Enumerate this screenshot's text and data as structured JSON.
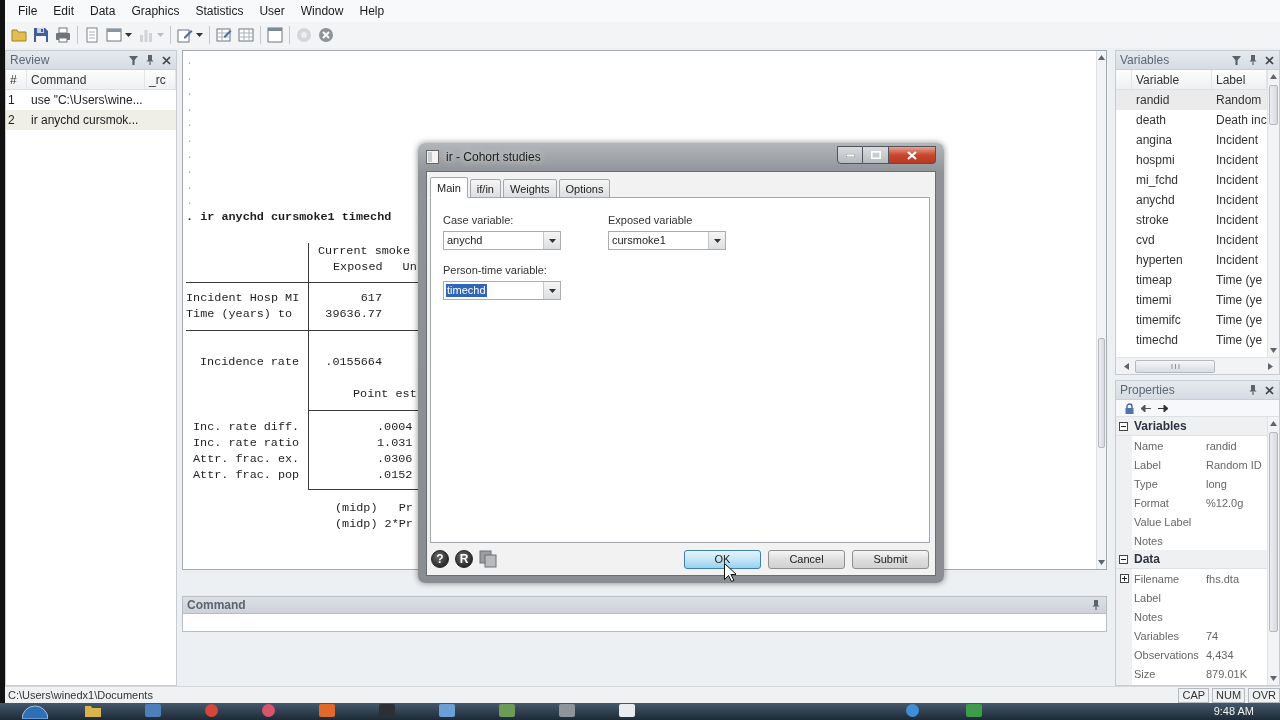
{
  "menu_bar": [
    "File",
    "Edit",
    "Data",
    "Graphics",
    "Statistics",
    "User",
    "Window",
    "Help"
  ],
  "review": {
    "title": "Review",
    "columns": [
      "#",
      "Command",
      "_rc"
    ],
    "rows": [
      {
        "number": "1",
        "command": "use \"C:\\Users\\wine...",
        "selected": false
      },
      {
        "number": "2",
        "command": "ir anychd cursmok...",
        "selected": true
      }
    ]
  },
  "results": {
    "echo_lines": [
      ".",
      ".",
      ".",
      ".",
      ".",
      ".",
      ".",
      ".",
      ".",
      "."
    ],
    "command": ". ir anychd cursmoke1 timechd",
    "table": {
      "header_lines": [
        [
          "Current smoke"
        ],
        [
          "Exposed",
          "Un"
        ]
      ],
      "count_rows": [
        {
          "label": "Incident Hosp MI",
          "value": "617"
        },
        {
          "label": "Time (years) to",
          "value": "39636.77"
        }
      ],
      "rate_row": {
        "label": "Incidence rate",
        "value": ".0155664"
      },
      "estimate_heading": "Point est",
      "estimate_rows": [
        {
          "label": "Inc. rate diff.",
          "value": ".0004"
        },
        {
          "label": "Inc. rate ratio",
          "value": "1.031"
        },
        {
          "label": "Attr. frac. ex.",
          "value": ".0306"
        },
        {
          "label": "Attr. frac. pop",
          "value": ".0152"
        }
      ]
    },
    "test_lines": [
      [
        "(midp)",
        "Pr"
      ],
      [
        "(midp)",
        "2*Pr"
      ]
    ]
  },
  "command_window": {
    "title": "Command"
  },
  "variables": {
    "title": "Variables",
    "columns": [
      "Variable",
      "Label"
    ],
    "rows": [
      {
        "name": "randid",
        "label": "Random",
        "selected": true
      },
      {
        "name": "death",
        "label": "Death inc",
        "selected": false
      },
      {
        "name": "angina",
        "label": "Incident",
        "selected": false
      },
      {
        "name": "hospmi",
        "label": "Incident",
        "selected": false
      },
      {
        "name": "mi_fchd",
        "label": "Incident",
        "selected": false
      },
      {
        "name": "anychd",
        "label": "Incident",
        "selected": false
      },
      {
        "name": "stroke",
        "label": "Incident",
        "selected": false
      },
      {
        "name": "cvd",
        "label": "Incident",
        "selected": false
      },
      {
        "name": "hyperten",
        "label": "Incident",
        "selected": false
      },
      {
        "name": "timeap",
        "label": "Time (ye",
        "selected": false
      },
      {
        "name": "timemi",
        "label": "Time (ye",
        "selected": false
      },
      {
        "name": "timemifc",
        "label": "Time (ye",
        "selected": false
      },
      {
        "name": "timechd",
        "label": "Time (ye",
        "selected": false
      }
    ]
  },
  "properties": {
    "title": "Properties",
    "groups": [
      {
        "title": "Variables",
        "expanded": true,
        "rows": [
          {
            "name": "Name",
            "value": "randid"
          },
          {
            "name": "Label",
            "value": "Random ID"
          },
          {
            "name": "Type",
            "value": "long"
          },
          {
            "name": "Format",
            "value": "%12.0g"
          },
          {
            "name": "Value Label"
          },
          {
            "name": "Notes"
          }
        ]
      },
      {
        "title": "Data",
        "expanded": true,
        "rows": [
          {
            "name": "Filename",
            "value": "fhs.dta",
            "expanded": false
          },
          {
            "name": "Label"
          },
          {
            "name": "Notes"
          },
          {
            "name": "Variables",
            "value": "74"
          },
          {
            "name": "Observations",
            "value": "4,434"
          },
          {
            "name": "Size",
            "value": "879.01K"
          }
        ]
      }
    ]
  },
  "dialog": {
    "title": "ir - Cohort studies",
    "tabs": [
      {
        "label": "Main",
        "selected": true
      },
      {
        "label": "if/in",
        "selected": false
      },
      {
        "label": "Weights",
        "selected": false
      },
      {
        "label": "Options",
        "selected": false
      }
    ],
    "fields": [
      {
        "label": "Case variable:",
        "value": "anychd",
        "highlighted": false
      },
      {
        "label": "Exposed variable",
        "value": "cursmoke1",
        "highlighted": false
      },
      {
        "label": "Person-time variable:",
        "value": "timechd",
        "highlighted": true
      }
    ],
    "tool_buttons": [
      {
        "kind": "help",
        "glyph": "?"
      },
      {
        "kind": "reset",
        "glyph": "R"
      },
      {
        "kind": "copy"
      }
    ],
    "buttons": [
      {
        "label": "OK",
        "focused": true
      },
      {
        "label": "Cancel",
        "focused": false
      },
      {
        "label": "Submit",
        "focused": false
      }
    ]
  },
  "status_bar": {
    "path": "C:\\Users\\winedx1\\Documents",
    "indicators": [
      "CAP",
      "NUM",
      "OVR"
    ]
  },
  "taskbar": {
    "clock": "9:48 AM"
  }
}
